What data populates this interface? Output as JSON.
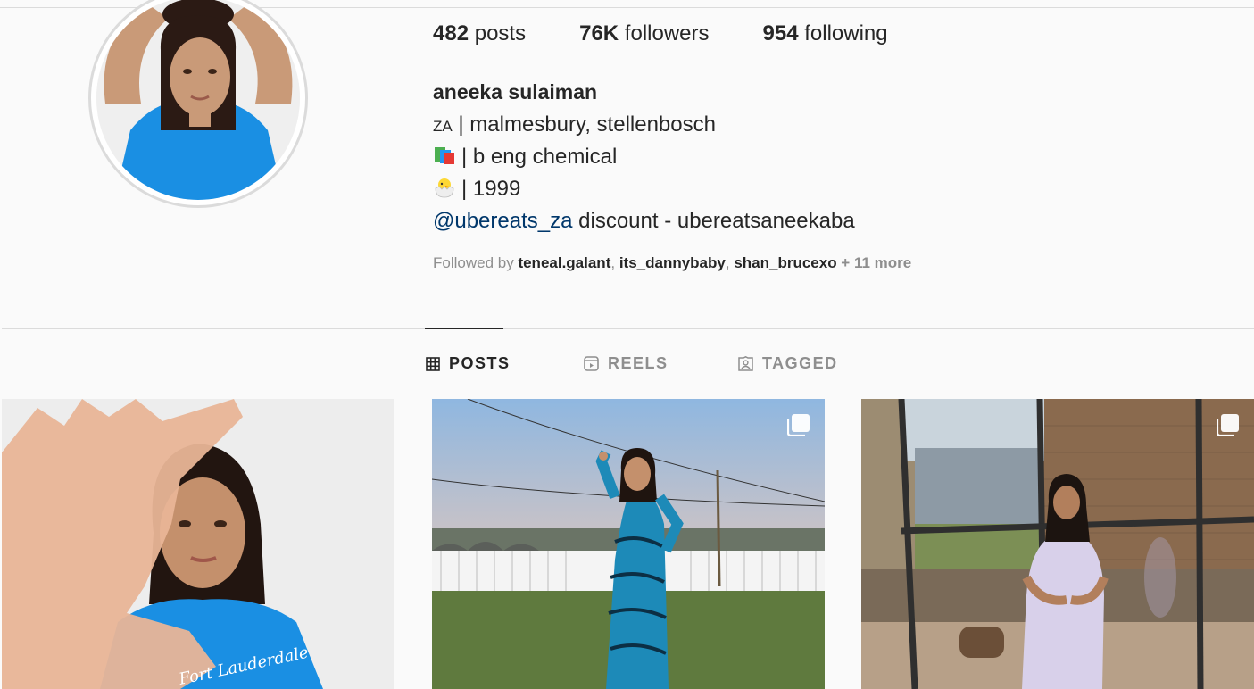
{
  "profile": {
    "stats": {
      "posts_count": "482",
      "posts_label": "posts",
      "followers_count": "76K",
      "followers_label": "followers",
      "following_count": "954",
      "following_label": "following"
    },
    "name": "aneeka sulaiman",
    "bio": {
      "line1_flag": "ZA",
      "line1_text": " | malmesbury, stellenbosch",
      "line2_icon": "books-icon",
      "line2_text": "| b eng chemical",
      "line3_icon": "hatching-chick-icon",
      "line3_text": "| 1999",
      "line4_mention": "@ubereats_za",
      "line4_text": " discount - ubereatsaneekaba"
    },
    "followed_by": {
      "prefix": "Followed by ",
      "user1": "teneal.galant",
      "sep1": ", ",
      "user2": "its_dannybaby",
      "sep2": ", ",
      "user3": "shan_brucexo",
      "more": " + 11 more"
    }
  },
  "tabs": [
    {
      "label": "POSTS",
      "icon": "grid-icon",
      "active": true
    },
    {
      "label": "REELS",
      "icon": "reels-icon",
      "active": false
    },
    {
      "label": "TAGGED",
      "icon": "tagged-icon",
      "active": false
    }
  ],
  "posts": [
    {
      "icon": "photo",
      "multi": false
    },
    {
      "icon": "photo",
      "multi": true
    },
    {
      "icon": "photo",
      "multi": true
    }
  ],
  "colors": {
    "accent_link": "#00376b",
    "text": "#262626",
    "muted": "#8e8e8e",
    "shirt_blue": "#1a8fe3"
  }
}
